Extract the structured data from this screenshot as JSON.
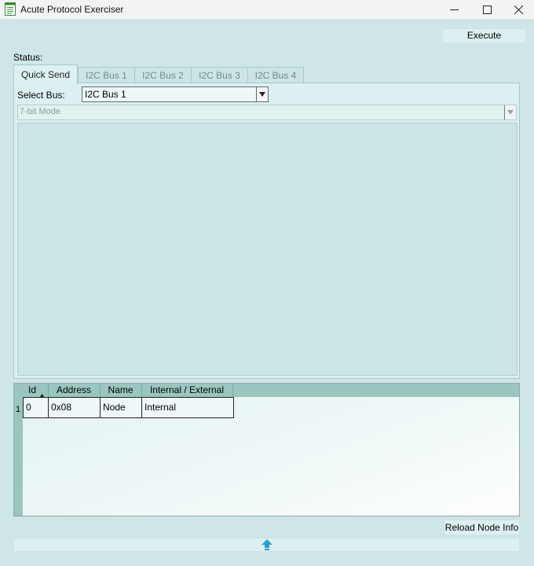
{
  "window": {
    "title": "Acute Protocol Exerciser"
  },
  "toolbar": {
    "execute_label": "Execute"
  },
  "status": {
    "label": "Status:"
  },
  "tabs": [
    {
      "label": "Quick Send",
      "active": true
    },
    {
      "label": "I2C Bus 1",
      "active": false
    },
    {
      "label": "I2C Bus 2",
      "active": false
    },
    {
      "label": "I2C Bus 3",
      "active": false
    },
    {
      "label": "I2C Bus 4",
      "active": false
    }
  ],
  "quick_send": {
    "select_bus_label": "Select Bus:",
    "bus_value": "I2C Bus 1",
    "mode_value": "7-bit Mode"
  },
  "node_table": {
    "columns": [
      "Id",
      "Address",
      "Name",
      "Internal / External"
    ],
    "sort_column": "Id",
    "sort_direction": "ascending",
    "rows": [
      {
        "row_number": "1",
        "id": "0",
        "address": "0x08",
        "name": "Node",
        "internal_external": "Internal"
      }
    ]
  },
  "footer": {
    "reload_label": "Reload Node Info"
  },
  "icons": {
    "app": "document-icon",
    "minimize": "minimize-icon",
    "maximize": "maximize-icon",
    "close": "close-icon",
    "sort": "sort-ascending-icon",
    "expand": "up-arrow-icon"
  },
  "colors": {
    "window_bg": "#cfe6e6",
    "accent": "#2a9fd6",
    "table_header": "#99c6bf"
  }
}
